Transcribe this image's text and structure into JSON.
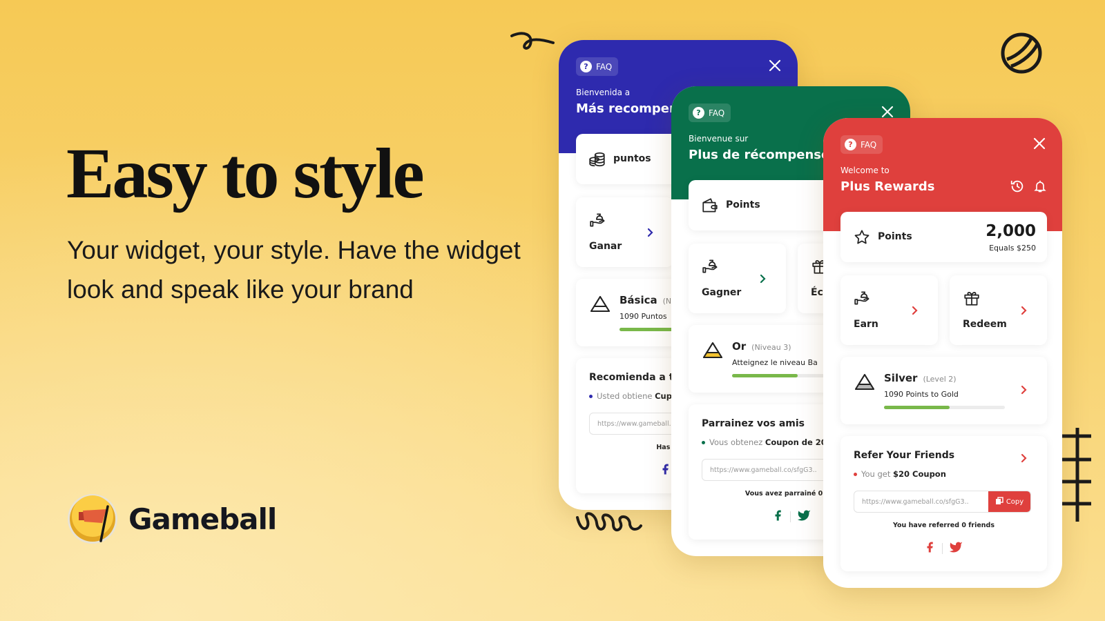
{
  "hero": {
    "title": "Easy to style",
    "subtitle": "Your widget, your style. Have the widget look and speak like your brand"
  },
  "brand": {
    "name": "Gameball",
    "logo": "flag-coin-logo"
  },
  "widgets": {
    "blue": {
      "color": "#2e2aae",
      "faq": "FAQ",
      "welcome": "Bienvenida a",
      "title": "Más recompens",
      "points": {
        "label": "puntos",
        "icon": "coins-icon"
      },
      "earn": {
        "label": "Ganar"
      },
      "tier": {
        "name": "Básica",
        "level": "(Niv",
        "progress_text": "1090 Puntos",
        "progress": 0.54,
        "tier_color": "#ffffff"
      },
      "refer": {
        "title": "Recomienda a tu",
        "bullet": "Usted obtiene",
        "bullet_bold": "Cup",
        "link": "https://www.gameball.co/sfgG3..",
        "referred": "Has referido"
      }
    },
    "green": {
      "color": "#09704b",
      "faq": "FAQ",
      "welcome": "Bienvenue sur",
      "title": "Plus de récompenses",
      "points": {
        "label": "Points",
        "icon": "wallet-icon"
      },
      "earn": {
        "label": "Gagner"
      },
      "redeem": {
        "label": "Échanger"
      },
      "tier": {
        "name": "Or",
        "level": "(Niveau 3)",
        "progress_text": "Atteignez le niveau Ba",
        "progress": 0.54,
        "tier_color": "#f2c230"
      },
      "refer": {
        "title": "Parrainez vos amis",
        "bullet": "Vous obtenez",
        "bullet_bold": "Coupon de 20",
        "link": "https://www.gameball.co/sfgG3..",
        "referred": "Vous avez parrainé 0 ami"
      }
    },
    "red": {
      "color": "#df403d",
      "faq": "FAQ",
      "welcome": "Welcome to",
      "title": "Plus Rewards",
      "points": {
        "label": "Points",
        "icon": "star-icon",
        "value": "2,000",
        "equals": "Equals $250"
      },
      "earn": {
        "label": "Earn"
      },
      "redeem": {
        "label": "Redeem"
      },
      "tier": {
        "name": "Silver",
        "level": "(Level 2)",
        "progress_text": "1090 Points to Gold",
        "progress": 0.54,
        "tier_color": "#b9b9b9"
      },
      "refer": {
        "title": "Refer Your Friends",
        "bullet": "You get",
        "bullet_bold": "$20 Coupon",
        "link": "https://www.gameball.co/sfgG3..",
        "copy": "Copy",
        "referred": "You have referred 0 friends"
      }
    }
  }
}
